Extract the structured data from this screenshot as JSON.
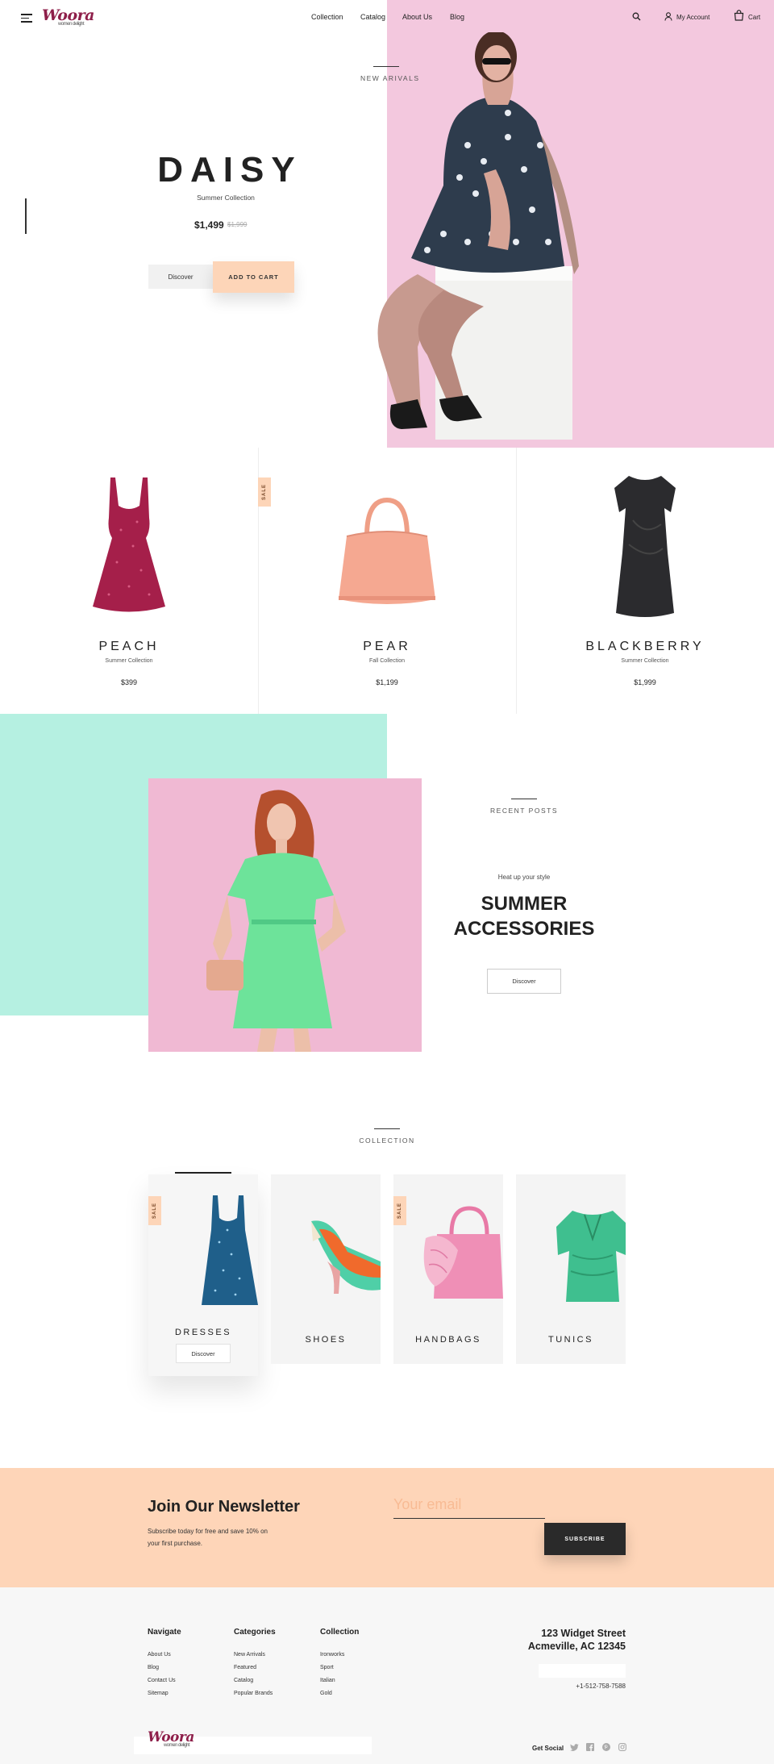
{
  "header": {
    "logo": "Woora",
    "tagline": "women delight",
    "nav": [
      "Collection",
      "Catalog",
      "About Us",
      "Blog"
    ],
    "account_label": "My Account",
    "cart_label": "Cart"
  },
  "hero": {
    "eyebrow": "NEW ARIVALS",
    "title": "DAISY",
    "subtitle": "Summer Collection",
    "price": "$1,499",
    "old_price": "$1,999",
    "discover_label": "Discover",
    "add_to_cart_label": "ADD TO CART"
  },
  "products": [
    {
      "name": "PEACH",
      "collection": "Summer Collection",
      "price": "$399",
      "badge": ""
    },
    {
      "name": "PEAR",
      "collection": "Fall Collection",
      "price": "$1,199",
      "badge": "SALE"
    },
    {
      "name": "BLACKBERRY",
      "collection": "Summer Collection",
      "price": "$1,999",
      "badge": ""
    }
  ],
  "recent_posts": {
    "eyebrow": "RECENT POSTS",
    "kicker": "Heat up your style",
    "title_line1": "SUMMER",
    "title_line2": "ACCESSORIES",
    "button": "Discover"
  },
  "collection": {
    "eyebrow": "COLLECTION",
    "cards": [
      {
        "name": "DRESSES",
        "badge": "SALE",
        "button": "Discover"
      },
      {
        "name": "SHOES",
        "badge": ""
      },
      {
        "name": "HANDBAGS",
        "badge": "SALE"
      },
      {
        "name": "TUNICS",
        "badge": ""
      }
    ]
  },
  "newsletter": {
    "title": "Join Our Newsletter",
    "text": "Subscribe today for free and save 10% on your first purchase.",
    "email_placeholder": "Your email",
    "button": "SUBSCRIBE"
  },
  "footer": {
    "columns": [
      {
        "title": "Navigate",
        "items": [
          "About Us",
          "Blog",
          "Contact Us",
          "Sitemap"
        ]
      },
      {
        "title": "Categories",
        "items": [
          "New Arrivals",
          "Featured",
          "Catalog",
          "Popular Brands"
        ]
      },
      {
        "title": "Collection",
        "items": [
          "Ironworks",
          "Sport",
          "Italian",
          "Gold"
        ]
      }
    ],
    "address_line1": "123 Widget Street",
    "address_line2": "Acmeville, AC 12345",
    "phone": "+1-512-758-7588",
    "logo": "Woora",
    "tagline": "women delight",
    "social_label": "Get Social",
    "social_icons": [
      "twitter-icon",
      "facebook-icon",
      "pinterest-icon",
      "instagram-icon"
    ]
  },
  "colors": {
    "pink": "#f3c8de",
    "peach": "#fed5b8",
    "mint": "#b5f0e1",
    "dark": "#2a2a2a",
    "brand": "#8e1f4a"
  }
}
